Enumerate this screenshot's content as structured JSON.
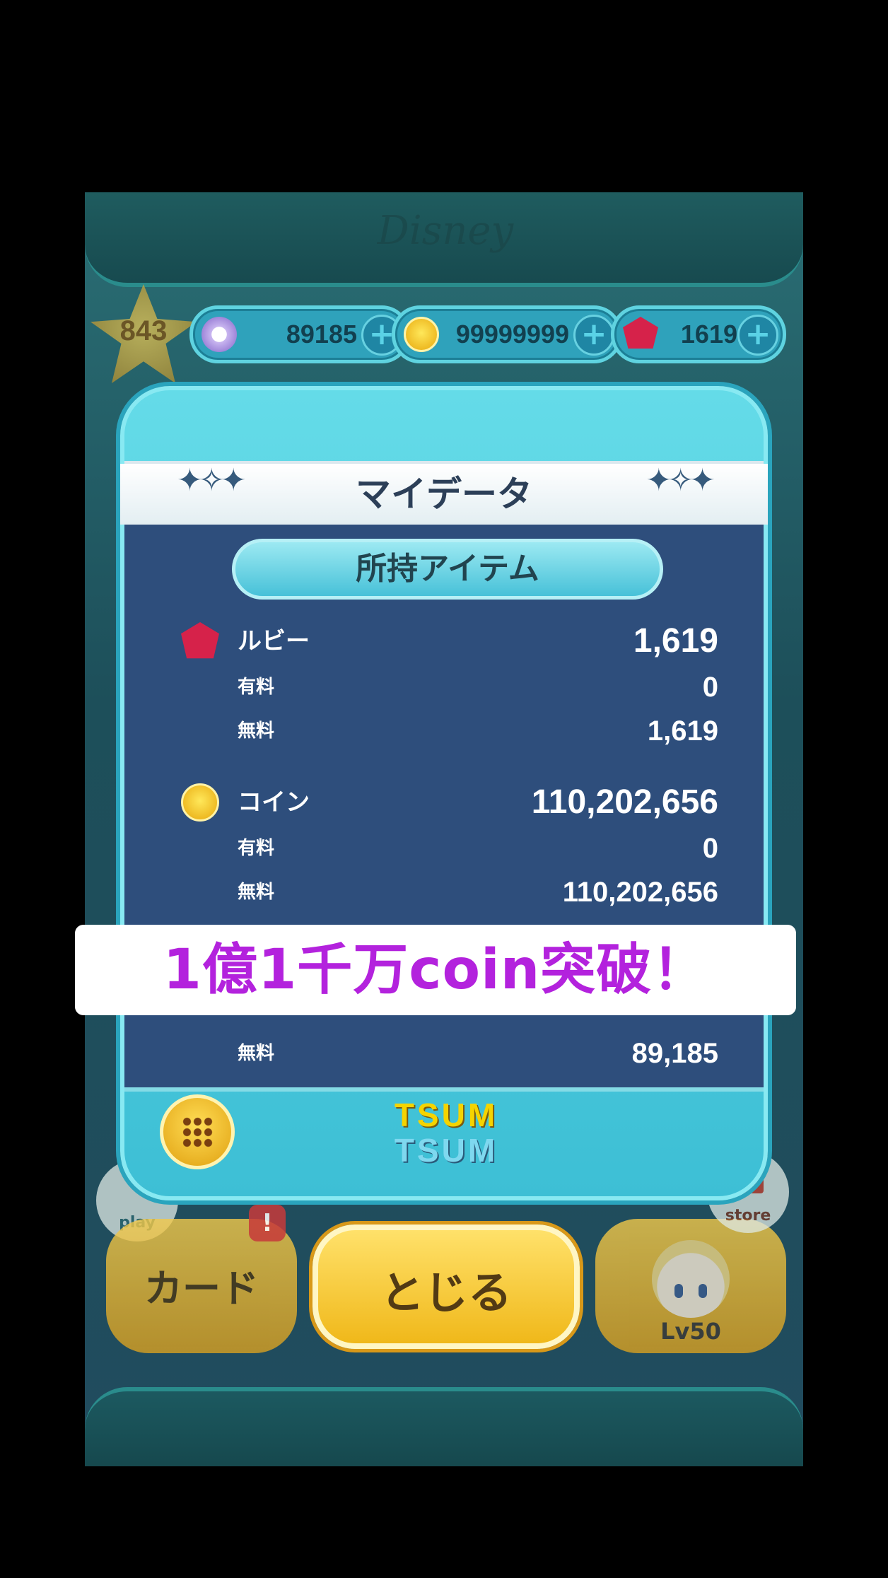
{
  "header": {
    "brand_mark": "Disney",
    "level": "843"
  },
  "currency": {
    "hearts_icon": "snowflake-badge-icon",
    "hearts": "89185",
    "coins_icon": "coin-icon",
    "coins": "99999999",
    "rubies_icon": "ruby-icon",
    "rubies": "1619",
    "plus_label": "+"
  },
  "panel": {
    "title": "マイデータ",
    "section": "所持アイテム",
    "ruby": {
      "label": "ルビー",
      "total": "1,619",
      "paid_label": "有料",
      "paid": "0",
      "free_label": "無料",
      "free": "1,619"
    },
    "coin": {
      "label": "コイン",
      "total": "110,202,656",
      "paid_label": "有料",
      "paid": "0",
      "free_label": "無料",
      "free": "110,202,656"
    },
    "partial": {
      "free_label": "無料",
      "free": "89,185"
    },
    "logo_line1": "TSUM",
    "logo_line2": "TSUM"
  },
  "buttons": {
    "card": "カード",
    "close": "とじる",
    "play_badge": "play",
    "alert_badge": "!",
    "store_badge": "store",
    "tsum_level": "Lv50"
  },
  "overlay": {
    "caption": "1億1千万coin突破！"
  },
  "colors": {
    "caption_text": "#b322dd",
    "panel": "#3dbfd5",
    "panel_inner": "#2e4e7c",
    "close_button": "#f0b81a"
  }
}
